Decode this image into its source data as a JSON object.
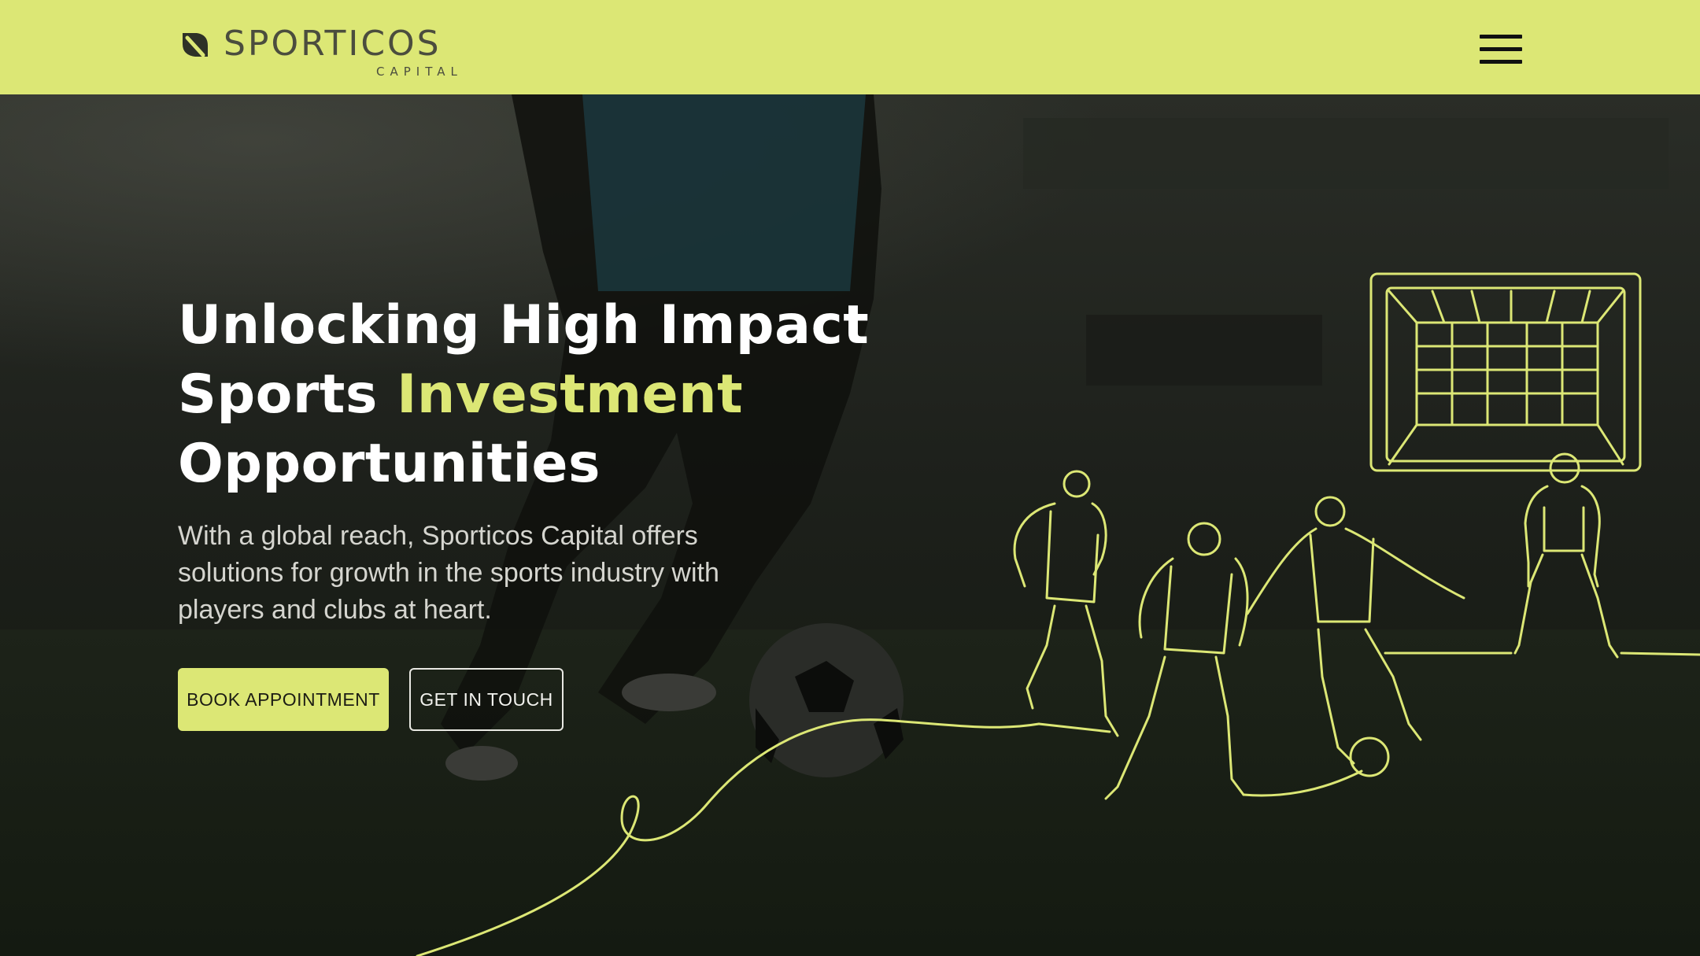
{
  "brand": {
    "name": "SPORTICOS",
    "sub": "CAPITAL",
    "accent_color": "#dce775"
  },
  "nav": {
    "menu_icon": "hamburger-menu-icon"
  },
  "hero": {
    "headline_line1": "Unlocking High Impact",
    "headline_line2_plain": "Sports ",
    "headline_line2_accent": "Investment",
    "headline_line3": "Opportunities",
    "description": "With a global reach, Sporticos Capital offers solutions for growth in the sports industry with players and clubs at heart.",
    "primary_cta": "BOOK APPOINTMENT",
    "secondary_cta": "GET IN TOUCH"
  },
  "illustration": {
    "icon": "soccer-players-line-art"
  }
}
